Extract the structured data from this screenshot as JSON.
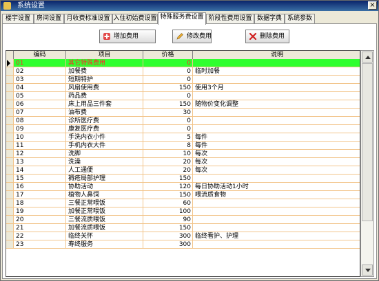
{
  "window": {
    "title": "系统设置",
    "close_label": "×"
  },
  "tabs": [
    "楼宇设置",
    "房间设置",
    "月收费标准设置",
    "入住初始费设置",
    "特殊服务费设置",
    "阶段性费用设置",
    "数据字典",
    "系统参数"
  ],
  "toolbar": {
    "add_label": "增加费用",
    "edit_label": "修改费用",
    "delete_label": "删除费用"
  },
  "table": {
    "columns": [
      "编码",
      "项目",
      "价格",
      "说明"
    ],
    "rows": [
      {
        "code": "01",
        "item": "其它特殊费用",
        "price": "0",
        "note": ""
      },
      {
        "code": "02",
        "item": "加餐费",
        "price": "0",
        "note": "临时加餐"
      },
      {
        "code": "03",
        "item": "短期特护",
        "price": "0",
        "note": ""
      },
      {
        "code": "04",
        "item": "风扇使用费",
        "price": "150",
        "note": "使用3个月"
      },
      {
        "code": "05",
        "item": "药品费",
        "price": "0",
        "note": ""
      },
      {
        "code": "06",
        "item": "床上用品三件套",
        "price": "150",
        "note": "随物价变化调整"
      },
      {
        "code": "07",
        "item": "油布费",
        "price": "30",
        "note": ""
      },
      {
        "code": "08",
        "item": "诊所医疗费",
        "price": "0",
        "note": ""
      },
      {
        "code": "09",
        "item": "康复医疗费",
        "price": "0",
        "note": ""
      },
      {
        "code": "10",
        "item": "手洗内衣小件",
        "price": "5",
        "note": "每件"
      },
      {
        "code": "11",
        "item": "手机内衣大件",
        "price": "8",
        "note": "每件"
      },
      {
        "code": "12",
        "item": "洗脚",
        "price": "10",
        "note": "每次"
      },
      {
        "code": "13",
        "item": "洗澡",
        "price": "20",
        "note": "每次"
      },
      {
        "code": "14",
        "item": "人工通便",
        "price": "20",
        "note": "每次"
      },
      {
        "code": "15",
        "item": "褥疮局部护理",
        "price": "150",
        "note": ""
      },
      {
        "code": "16",
        "item": "协助活动",
        "price": "120",
        "note": "每日协助活动1小时"
      },
      {
        "code": "17",
        "item": "植物人鼻饲",
        "price": "150",
        "note": "喂流质食物"
      },
      {
        "code": "18",
        "item": "三餐正常喂饭",
        "price": "60",
        "note": ""
      },
      {
        "code": "19",
        "item": "加餐正常喂饭",
        "price": "100",
        "note": ""
      },
      {
        "code": "20",
        "item": "三餐流质喂饭",
        "price": "90",
        "note": ""
      },
      {
        "code": "21",
        "item": "加餐流质喂饭",
        "price": "150",
        "note": ""
      },
      {
        "code": "22",
        "item": "临终关怀",
        "price": "300",
        "note": "临终看护、护理"
      },
      {
        "code": "23",
        "item": "寿终服务",
        "price": "300",
        "note": ""
      }
    ]
  },
  "colors": {
    "selected_row_bg": "#2fff2f",
    "selected_row_text": "#ff2a2a",
    "grid_line": "#f2c48a"
  }
}
